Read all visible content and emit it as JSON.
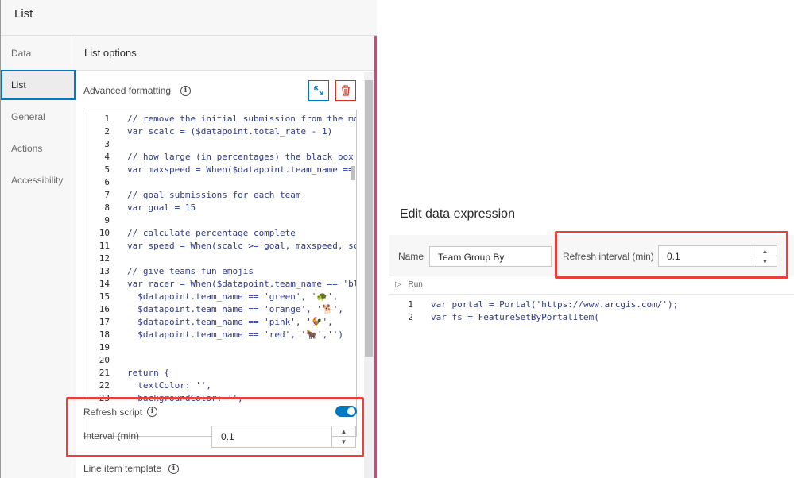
{
  "window": {
    "title": "List"
  },
  "nav": {
    "items": [
      {
        "label": "Data",
        "active": false
      },
      {
        "label": "List",
        "active": true
      },
      {
        "label": "General",
        "active": false
      },
      {
        "label": "Actions",
        "active": false
      },
      {
        "label": "Accessibility",
        "active": false
      }
    ]
  },
  "options": {
    "header": "List options",
    "advanced_formatting_label": "Advanced formatting",
    "info_icon": "info-icon",
    "expand_icon": "expand-icon",
    "delete_icon": "trash-icon",
    "code_lines": [
      {
        "n": "1",
        "text": "// remove the initial submission from the mov"
      },
      {
        "n": "2",
        "text": "var scalc = ($datapoint.total_rate - 1)"
      },
      {
        "n": "3",
        "text": ""
      },
      {
        "n": "4",
        "text": "// how large (in percentages) the black box c"
      },
      {
        "n": "5",
        "text": "var maxspeed = When($datapoint.team_name == '"
      },
      {
        "n": "6",
        "text": ""
      },
      {
        "n": "7",
        "text": "// goal submissions for each team"
      },
      {
        "n": "8",
        "text": "var goal = 15"
      },
      {
        "n": "9",
        "text": ""
      },
      {
        "n": "10",
        "text": "// calculate percentage complete"
      },
      {
        "n": "11",
        "text": "var speed = When(scalc >= goal, maxspeed, sca"
      },
      {
        "n": "12",
        "text": ""
      },
      {
        "n": "13",
        "text": "// give teams fun emojis"
      },
      {
        "n": "14",
        "text": "var racer = When($datapoint.team_name == 'blu"
      },
      {
        "n": "15",
        "text": "  $datapoint.team_name == 'green', '🐢',"
      },
      {
        "n": "16",
        "text": "  $datapoint.team_name == 'orange', '🐕',"
      },
      {
        "n": "17",
        "text": "  $datapoint.team_name == 'pink', '🐓',"
      },
      {
        "n": "18",
        "text": "  $datapoint.team_name == 'red', '🐂','')"
      },
      {
        "n": "19",
        "text": ""
      },
      {
        "n": "20",
        "text": ""
      },
      {
        "n": "21",
        "text": "return {"
      },
      {
        "n": "22",
        "text": "  textColor: '',"
      },
      {
        "n": "23",
        "text": "  backgroundColor: '',"
      }
    ],
    "refresh_script_label": "Refresh script",
    "refresh_script_enabled": true,
    "interval_label": "Interval (min)",
    "interval_value": "0.1",
    "line_item_template_label": "Line item template"
  },
  "expression": {
    "title": "Edit data expression",
    "name_label": "Name",
    "name_value": "Team Group By",
    "refresh_label": "Refresh interval (min)",
    "refresh_value": "0.1",
    "run_label": "Run",
    "code_lines": [
      {
        "n": "1",
        "text": "var portal = Portal('https://www.arcgis.com/');"
      },
      {
        "n": "2",
        "text": "var fs = FeatureSetByPortalItem("
      }
    ]
  },
  "colors": {
    "accent": "#0079c1",
    "highlight": "#e8403c",
    "divider": "#e0417a",
    "delete": "#d83020"
  }
}
